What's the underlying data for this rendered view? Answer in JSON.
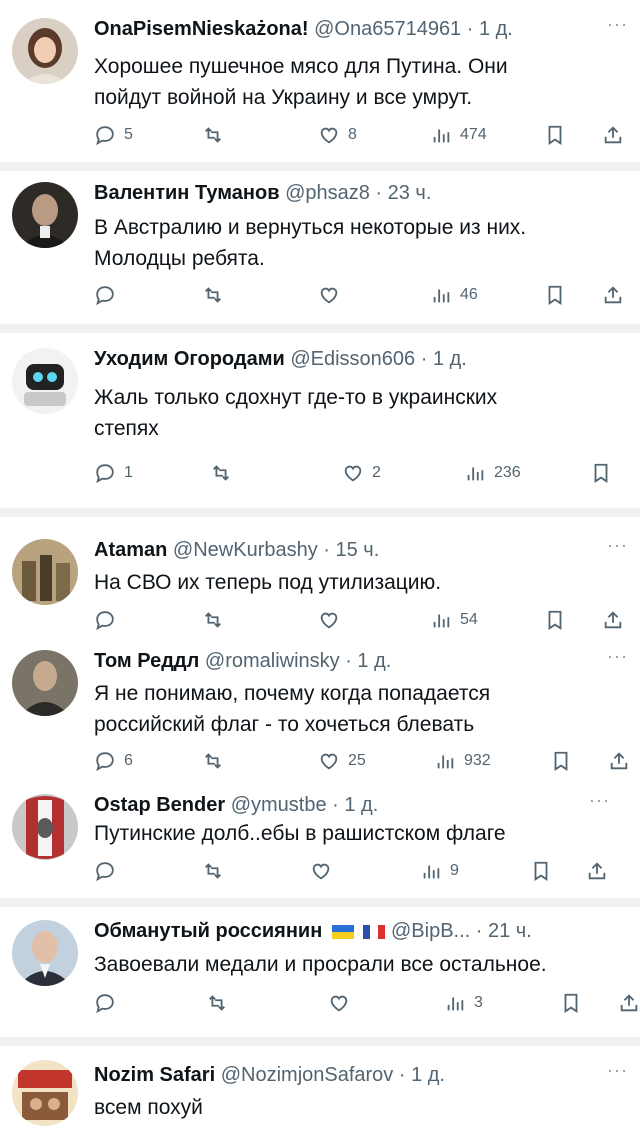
{
  "tweets": [
    {
      "name": "OnaPisemNieskażona!",
      "handle": "@Ona65714961 · 1 д.",
      "text": [
        "Хорошее пушечное мясо для Путина. Они",
        "пойдут войной на Украину и все умрут."
      ],
      "replies": "5",
      "likes": "8",
      "views": "474"
    },
    {
      "name": "Валентин Туманов",
      "handle": "@phsaz8 · 23 ч.",
      "text": [
        "В Австралию и вернуться некоторые из них.",
        "Молодцы ребята."
      ],
      "replies": "",
      "likes": "",
      "views": "46"
    },
    {
      "name": "Уходим Огородами",
      "handle": "@Edisson606 · 1 д.",
      "text": [
        "Жаль только сдохнут где-то в украинских",
        "степях"
      ],
      "replies": "1",
      "likes": "2",
      "views": "236"
    },
    {
      "name": "Ataman",
      "handle": "@NewKurbashy · 15 ч.",
      "text": [
        "На СВО их теперь под утилизацию."
      ],
      "replies": "",
      "likes": "",
      "views": "54"
    },
    {
      "name": "Том Реддл",
      "handle": "@romaliwinsky · 1 д.",
      "text": [
        "Я не понимаю, почему когда попадается",
        "российский флаг - то хочеться блевать"
      ],
      "replies": "6",
      "likes": "25",
      "views": "932"
    },
    {
      "name": "Ostap Bender",
      "handle": "@ymustbe · 1 д.",
      "text": [
        "Путинские долб..ебы в рашистском флаге"
      ],
      "replies": "",
      "likes": "",
      "views": "9"
    },
    {
      "name": "Обманутый россиянин",
      "handle": "@BipB... · 21 ч.",
      "text": [
        "Завоевали медали и просрали все остальное."
      ],
      "replies": "",
      "likes": "",
      "views": "3"
    },
    {
      "name": "Nozim Safari",
      "handle": "@NozimjonSafarov · 1 д.",
      "text": [
        "всем похуй"
      ],
      "replies": "",
      "likes": "",
      "views": ""
    }
  ],
  "more_glyph": "···",
  "icons": [
    "reply-icon",
    "retweet-icon",
    "like-icon",
    "views-icon",
    "bookmark-icon",
    "share-icon",
    "more-icon"
  ],
  "colors": {
    "text": "#0f1419",
    "secondary": "#536471",
    "separator": "#eff1f3"
  }
}
